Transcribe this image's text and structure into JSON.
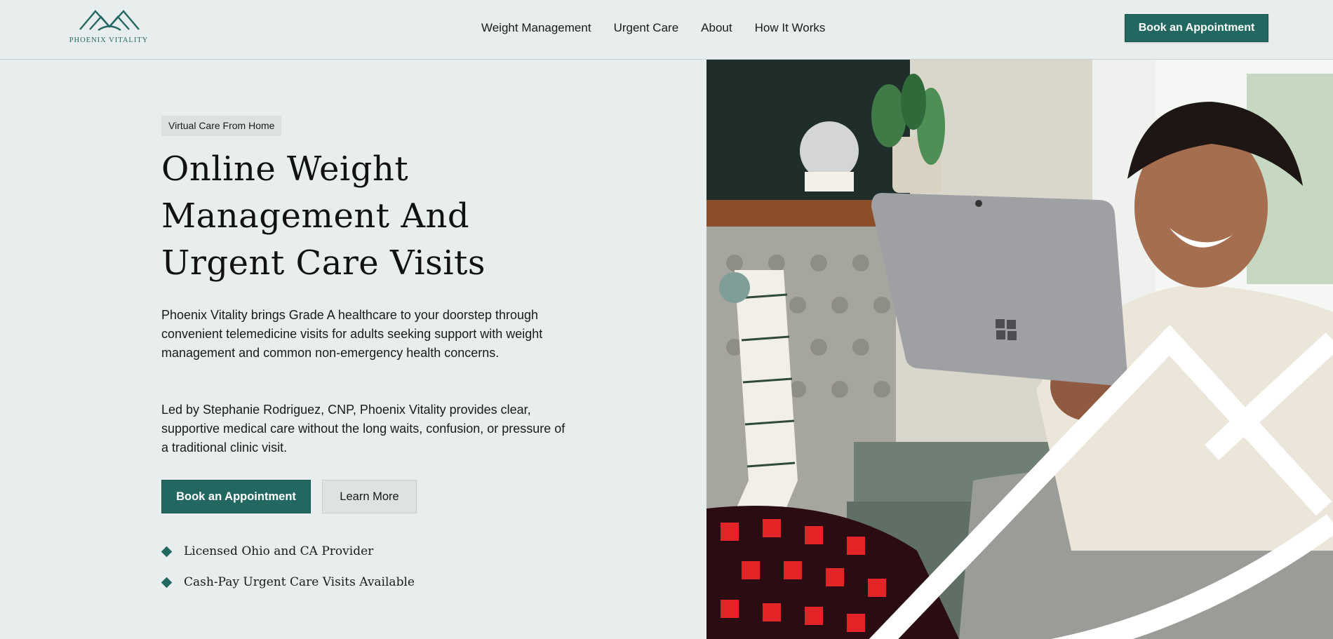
{
  "header": {
    "logo_text": "PHOENIX VITALITY",
    "nav": [
      "Weight Management",
      "Urgent Care",
      "About",
      "How It Works"
    ],
    "cta": "Book an Appointment"
  },
  "hero": {
    "badge": "Virtual Care From Home",
    "headline_lines": [
      "Online Weight",
      "Management And",
      "Urgent Care Visits"
    ],
    "paragraph1": "Phoenix Vitality brings Grade A healthcare to your doorstep through convenient telemedicine visits for adults seeking support with weight management and common non-emergency health concerns.",
    "paragraph2": "Led by Stephanie Rodriguez, CNP, Phoenix Vitality provides clear, supportive medical care without the long waits, confusion, or pressure of a traditional clinic visit.",
    "primary_button": "Book an Appointment",
    "secondary_button": "Learn More",
    "features": [
      "Licensed Ohio and CA Provider",
      "Cash-Pay Urgent Care Visits Available"
    ]
  },
  "colors": {
    "brand": "#236860",
    "background": "#e8eeee"
  },
  "icons": {
    "logo": "mountain-logo-icon",
    "bullet": "diamond-bullet-icon"
  }
}
